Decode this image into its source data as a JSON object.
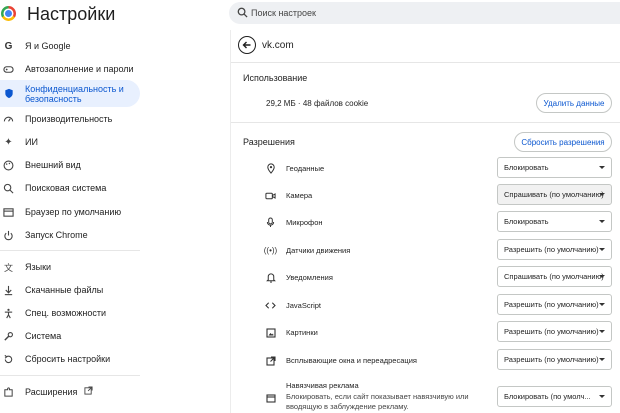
{
  "app": {
    "title": "Настройки"
  },
  "search": {
    "placeholder": "Поиск настроек"
  },
  "sidebar": {
    "items": [
      {
        "label": "Я и Google",
        "icon": "google-icon"
      },
      {
        "label": "Автозаполнение и пароли",
        "icon": "autofill-icon"
      },
      {
        "label": "Конфиденциальность и безопасность",
        "icon": "shield-icon",
        "active": true
      },
      {
        "label": "Производительность",
        "icon": "performance-icon"
      },
      {
        "label": "ИИ",
        "icon": "sparkle-icon"
      },
      {
        "label": "Внешний вид",
        "icon": "palette-icon"
      },
      {
        "label": "Поисковая система",
        "icon": "search-icon"
      },
      {
        "label": "Браузер по умолчанию",
        "icon": "browser-icon"
      },
      {
        "label": "Запуск Chrome",
        "icon": "power-icon"
      },
      {
        "label": "Языки",
        "icon": "translate-icon"
      },
      {
        "label": "Скачанные файлы",
        "icon": "download-icon"
      },
      {
        "label": "Спец. возможности",
        "icon": "accessibility-icon"
      },
      {
        "label": "Система",
        "icon": "wrench-icon"
      },
      {
        "label": "Сбросить настройки",
        "icon": "reset-icon"
      },
      {
        "label": "Расширения",
        "icon": "puzzle-icon"
      }
    ]
  },
  "site": {
    "title": "vk.com",
    "usage_heading": "Использование",
    "usage_text": "29,2 МБ · 48 файлов cookie",
    "delete_button": "Удалить данные",
    "permissions_heading": "Разрешения",
    "reset_button": "Сбросить разрешения"
  },
  "permissions": [
    {
      "label": "Геоданные",
      "value": "Блокировать",
      "icon": "location-icon"
    },
    {
      "label": "Камера",
      "value": "Спрашивать (по умолчанию)",
      "icon": "camera-icon",
      "disabled": true
    },
    {
      "label": "Микрофон",
      "value": "Блокировать",
      "icon": "microphone-icon"
    },
    {
      "label": "Датчики движения",
      "value": "Разрешить (по умолчанию)",
      "icon": "motion-sensor-icon"
    },
    {
      "label": "Уведомления",
      "value": "Спрашивать (по умолчанию)",
      "icon": "bell-icon"
    },
    {
      "label": "JavaScript",
      "value": "Разрешить (по умолчанию)",
      "icon": "code-icon"
    },
    {
      "label": "Картинки",
      "value": "Разрешить (по умолчанию)",
      "icon": "image-icon"
    },
    {
      "label": "Всплывающие окна и переадресация",
      "value": "Разрешить (по умолчанию)",
      "icon": "popup-icon"
    },
    {
      "label": "Навязчивая реклама",
      "sublabel": "Блокировать, если сайт показывает навязчивую или вводящую в заблуждение рекламу.",
      "value": "Блокировать (по умолч...",
      "icon": "ads-icon"
    }
  ]
}
